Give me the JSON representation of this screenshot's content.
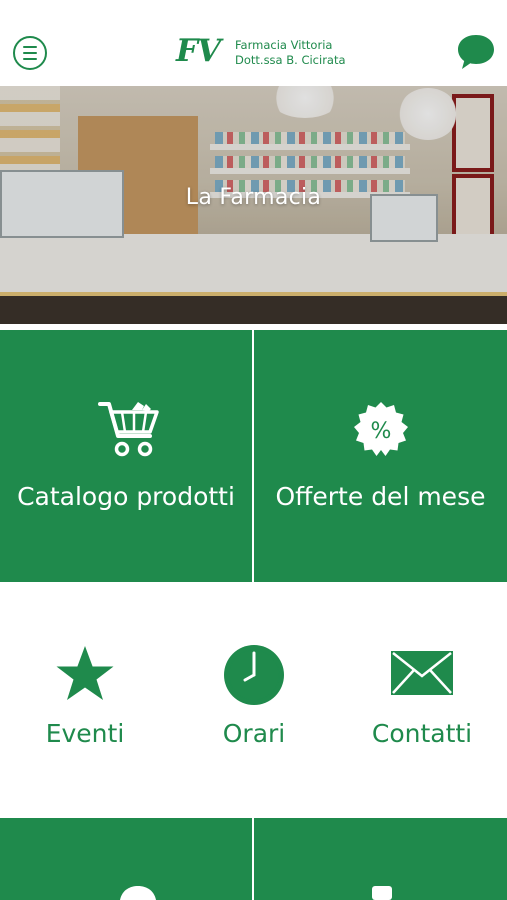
{
  "header": {
    "logo_mark": "FV",
    "brand_line1": "Farmacia Vittoria",
    "brand_line2": "Dott.ssa B. Cicirata",
    "menu_icon": "hamburger-menu-icon",
    "chat_icon": "chat-bubble-icon"
  },
  "hero": {
    "title": "La Farmacia"
  },
  "tiles": {
    "catalog": {
      "label": "Catalogo prodotti",
      "icon": "shopping-cart-icon"
    },
    "offers": {
      "label": "Offerte del mese",
      "icon": "percent-badge-icon",
      "badge_text": "%"
    }
  },
  "quick_links": [
    {
      "label": "Eventi",
      "icon": "star-icon"
    },
    {
      "label": "Orari",
      "icon": "clock-icon"
    },
    {
      "label": "Contatti",
      "icon": "envelope-icon"
    }
  ],
  "colors": {
    "brand_green": "#1f8a4c",
    "white": "#ffffff"
  }
}
